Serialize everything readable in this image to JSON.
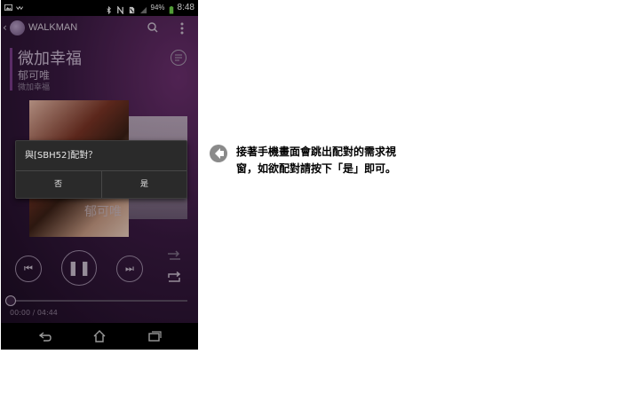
{
  "status_bar": {
    "battery": "94%",
    "time": "8:48"
  },
  "app": {
    "title": "WALKMAN"
  },
  "now_playing": {
    "title": "微加幸福",
    "artist": "郁可唯",
    "album": "微加幸福",
    "cover_overlay_text": "郁可唯"
  },
  "playback": {
    "elapsed_total": "00:00 / 04:44",
    "progress": 0
  },
  "dialog": {
    "message": "與[SBH52]配對？",
    "no_label": "否",
    "yes_label": "是"
  },
  "annotation": {
    "text": "接著手機畫面會跳出配對的需求視窗，如欲配對請按下「是」即可。"
  },
  "colors": {
    "app_bg": "#3a1a42",
    "accent": "#7a3b8a",
    "dialog_bg": "#2a2a2a",
    "arrow": "#8a8a8a"
  }
}
